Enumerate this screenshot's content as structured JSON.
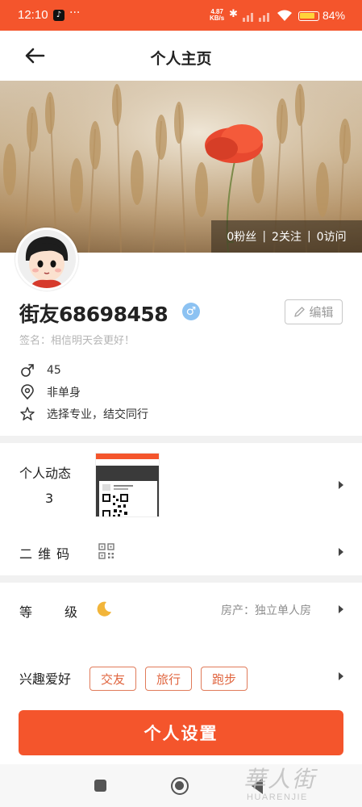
{
  "status_bar": {
    "time": "12:10",
    "app_icon": "tiktok-icon",
    "more": "···",
    "net_speed_value": "4.87",
    "net_speed_unit": "KB/s",
    "battery_percent": "84%",
    "battery_level": 0.84,
    "icons": [
      "bluetooth-icon",
      "signal-icon",
      "wifi-icon",
      "battery-icon"
    ]
  },
  "header": {
    "title": "个人主页",
    "back_icon": "back-arrow-icon"
  },
  "banner": {
    "stats": {
      "fans": "0粉丝",
      "following": "2关注",
      "visits": "0访问",
      "separator": "|"
    }
  },
  "profile": {
    "username": "街友68698458",
    "gender_symbol": "♂",
    "edit_label": "编辑",
    "signature": "签名：相信明天会更好！",
    "info": [
      {
        "icon": "male-icon",
        "text": "45"
      },
      {
        "icon": "location-icon",
        "text": "非单身"
      },
      {
        "icon": "star-outline-icon",
        "text": "选择专业，结交同行"
      }
    ]
  },
  "sections": {
    "dynamics_label": "个人动态",
    "dynamics_count": "3",
    "thumb_caption": "我的二维码",
    "qr_label": "二 维 码",
    "level_label_a": "等",
    "level_label_b": "级",
    "house": "房产：独立单人房",
    "hobby_label": "兴趣爱好",
    "hobbies": [
      "交友",
      "旅行",
      "跑步"
    ]
  },
  "actions": {
    "settings_label": "个人设置"
  },
  "watermark": {
    "cn": "華人街",
    "en": "HUARENJIE"
  },
  "colors": {
    "brand": "#f4552c",
    "tag": "#e0653f",
    "gender_badge": "#8cc2f2",
    "moon": "#f2b53a"
  }
}
